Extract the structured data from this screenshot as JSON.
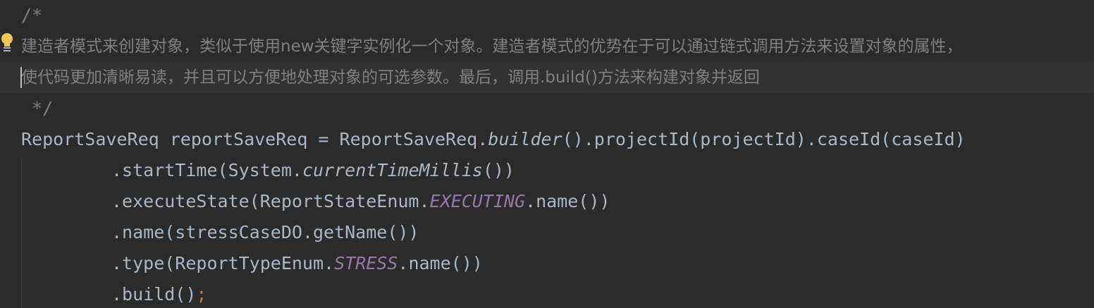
{
  "editor": {
    "lines": [
      {
        "text": "/*"
      },
      {
        "text": "建造者模式来创建对象，类似于使用new关键字实例化一个对象。建造者模式的优势在于可以通过链式调用方法来设置对象的属性，"
      },
      {
        "text": "使代码更加清晰易读，并且可以方便地处理对象的可选参数。最后，调用.build()方法来构建对象并返回"
      },
      {
        "text": " */"
      },
      {
        "pre": "ReportSaveReq reportSaveReq = ReportSaveReq.",
        "method": "builder",
        "post": "().projectId(projectId).caseId(caseId)"
      },
      {
        "pre": ".startTime(System.",
        "method": "currentTimeMillis",
        "post": "())"
      },
      {
        "pre": ".executeState(ReportStateEnum.",
        "constant": "EXECUTING",
        "post": ".name())"
      },
      {
        "text": ".name(stressCaseDO.getName())"
      },
      {
        "pre": ".type(ReportTypeEnum.",
        "constant": "STRESS",
        "post": ".name())"
      },
      {
        "pre": ".build()",
        "semicolon": ";"
      }
    ]
  },
  "colors": {
    "background": "#2b2b2b",
    "current_line": "#323232",
    "comment": "#808080",
    "default_text": "#a9b7c6",
    "constant": "#9876aa",
    "keyword": "#cc7832",
    "bulb": "#f2c55c"
  },
  "icons": {
    "gutter": "intention-bulb-icon"
  }
}
